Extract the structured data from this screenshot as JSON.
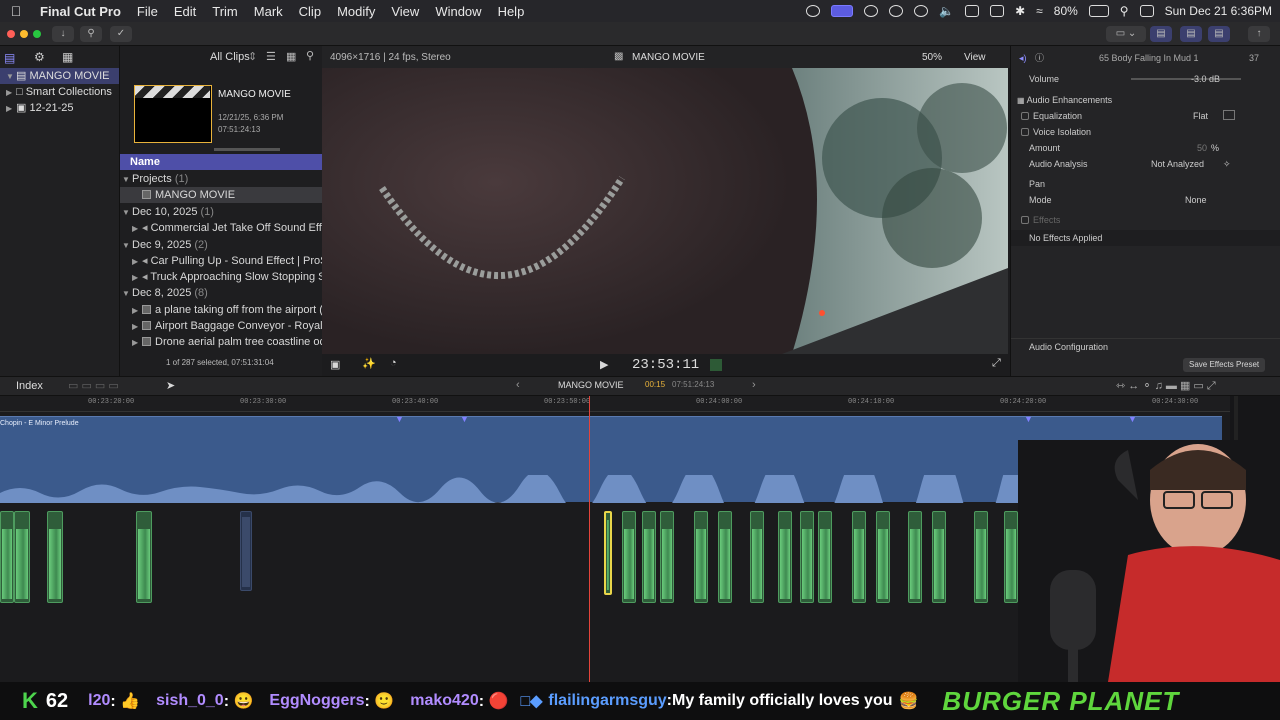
{
  "menubar": {
    "app": "Final Cut Pro",
    "items": [
      "File",
      "Edit",
      "Trim",
      "Mark",
      "Clip",
      "Modify",
      "View",
      "Window",
      "Help"
    ],
    "battery": "80%",
    "datetime": "Sun Dec 21  6:36PM"
  },
  "library": {
    "rows": [
      {
        "label": "MANGO MOVIE",
        "icon": "library-icon"
      },
      {
        "label": "Smart Collections",
        "icon": "folder-icon"
      },
      {
        "label": "12-21-25",
        "icon": "event-icon"
      }
    ]
  },
  "browser": {
    "filter": "All Clips",
    "project_title": "MANGO MOVIE",
    "project_date": "12/21/25, 6:36 PM",
    "project_duration": "07:51:24:13",
    "column_name": "Name",
    "rows": [
      {
        "label": "Projects",
        "count": "(1)",
        "kind": "group"
      },
      {
        "label": "MANGO MOVIE",
        "kind": "project"
      },
      {
        "label": "Dec 10, 2025",
        "count": "(1)",
        "kind": "group"
      },
      {
        "label": "Commercial Jet Take Off Sound Effect",
        "kind": "clip"
      },
      {
        "label": "Dec 9, 2025",
        "count": "(2)",
        "kind": "group"
      },
      {
        "label": "Car Pulling Up - Sound Effect  |  ProSoun",
        "kind": "clip"
      },
      {
        "label": "Truck Approaching Slow Stopping Sound",
        "kind": "clip"
      },
      {
        "label": "Dec 8, 2025",
        "count": "(8)",
        "kind": "group"
      },
      {
        "label": "a plane taking off from the airport ( 4K ro",
        "kind": "clip"
      },
      {
        "label": "Airport Baggage Conveyor - Royalty Free",
        "kind": "clip"
      },
      {
        "label": "Drone aerial palm tree coastline ocean be",
        "kind": "clip"
      }
    ],
    "status": "1 of 287 selected, 07:51:31:04"
  },
  "viewer": {
    "format": "4096×1716 | 24 fps, Stereo",
    "title": "MANGO MOVIE",
    "zoom": "50%",
    "view_label": "View",
    "timecode": "23:53:11"
  },
  "inspector": {
    "clip_title": "65 Body Falling In Mud 1",
    "clip_count": "37",
    "volume_label": "Volume",
    "volume_value": "-3.0  dB",
    "enhancements": "Audio Enhancements",
    "equalization": "Equalization",
    "eq_value": "Flat",
    "voice_isolation": "Voice Isolation",
    "amount": "Amount",
    "amount_value": "50",
    "amount_unit": "%",
    "audio_analysis": "Audio Analysis",
    "analysis_value": "Not Analyzed",
    "pan": "Pan",
    "mode": "Mode",
    "mode_value": "None",
    "effects": "Effects",
    "no_effects": "No Effects Applied",
    "audio_config": "Audio Configuration",
    "save_preset": "Save Effects Preset"
  },
  "timeline": {
    "index": "Index",
    "project": "MANGO MOVIE",
    "position": "00:15",
    "duration": "07:51:24:13",
    "ruler": [
      "00:23:20:00",
      "00:23:30:00",
      "00:23:40:00",
      "00:23:50:00",
      "00:24:00:00",
      "00:24:10:00",
      "00:24:20:00",
      "00:24:30:00"
    ],
    "music_clip": "Chopin - E Minor Prelude"
  },
  "ticker": {
    "score": "62",
    "items": [
      {
        "user": "l20",
        "msg": "",
        "color": "#b18cff"
      },
      {
        "user": "sish_0_0",
        "msg": "",
        "color": "#b18cff"
      },
      {
        "user": "EggNoggers",
        "msg": "",
        "color": "#b18cff"
      },
      {
        "user": "mako420",
        "msg": "",
        "color": "#b18cff"
      },
      {
        "user": "flailingarmsguy",
        "msg": "My family officially loves you",
        "color": "#5b9dff"
      }
    ],
    "brand": "BURGER PLANET"
  },
  "colors": {
    "accent": "#4e4fa8",
    "clip_green": "#4e9c5f",
    "music_blue": "#3b5a8c",
    "playhead": "#e4443a",
    "brand": "#5fd63d"
  }
}
